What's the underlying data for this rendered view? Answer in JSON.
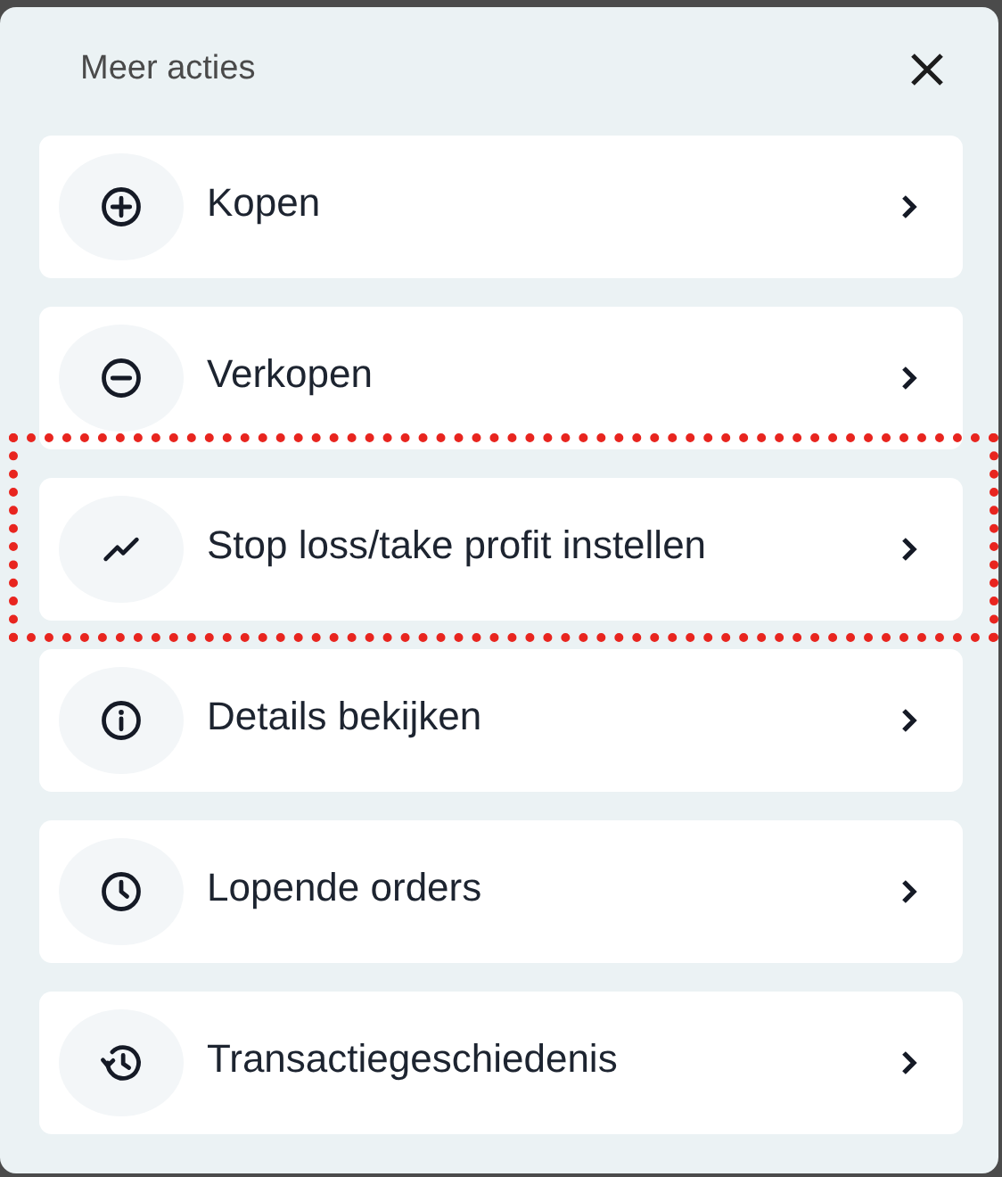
{
  "title": "Meer acties",
  "actions": [
    {
      "label": "Kopen",
      "highlighted": false
    },
    {
      "label": "Verkopen",
      "highlighted": false
    },
    {
      "label": "Stop loss/take profit instellen",
      "highlighted": true
    },
    {
      "label": "Details bekijken",
      "highlighted": false
    },
    {
      "label": "Lopende orders",
      "highlighted": false
    },
    {
      "label": "Transactiegeschiedenis",
      "highlighted": false
    }
  ]
}
